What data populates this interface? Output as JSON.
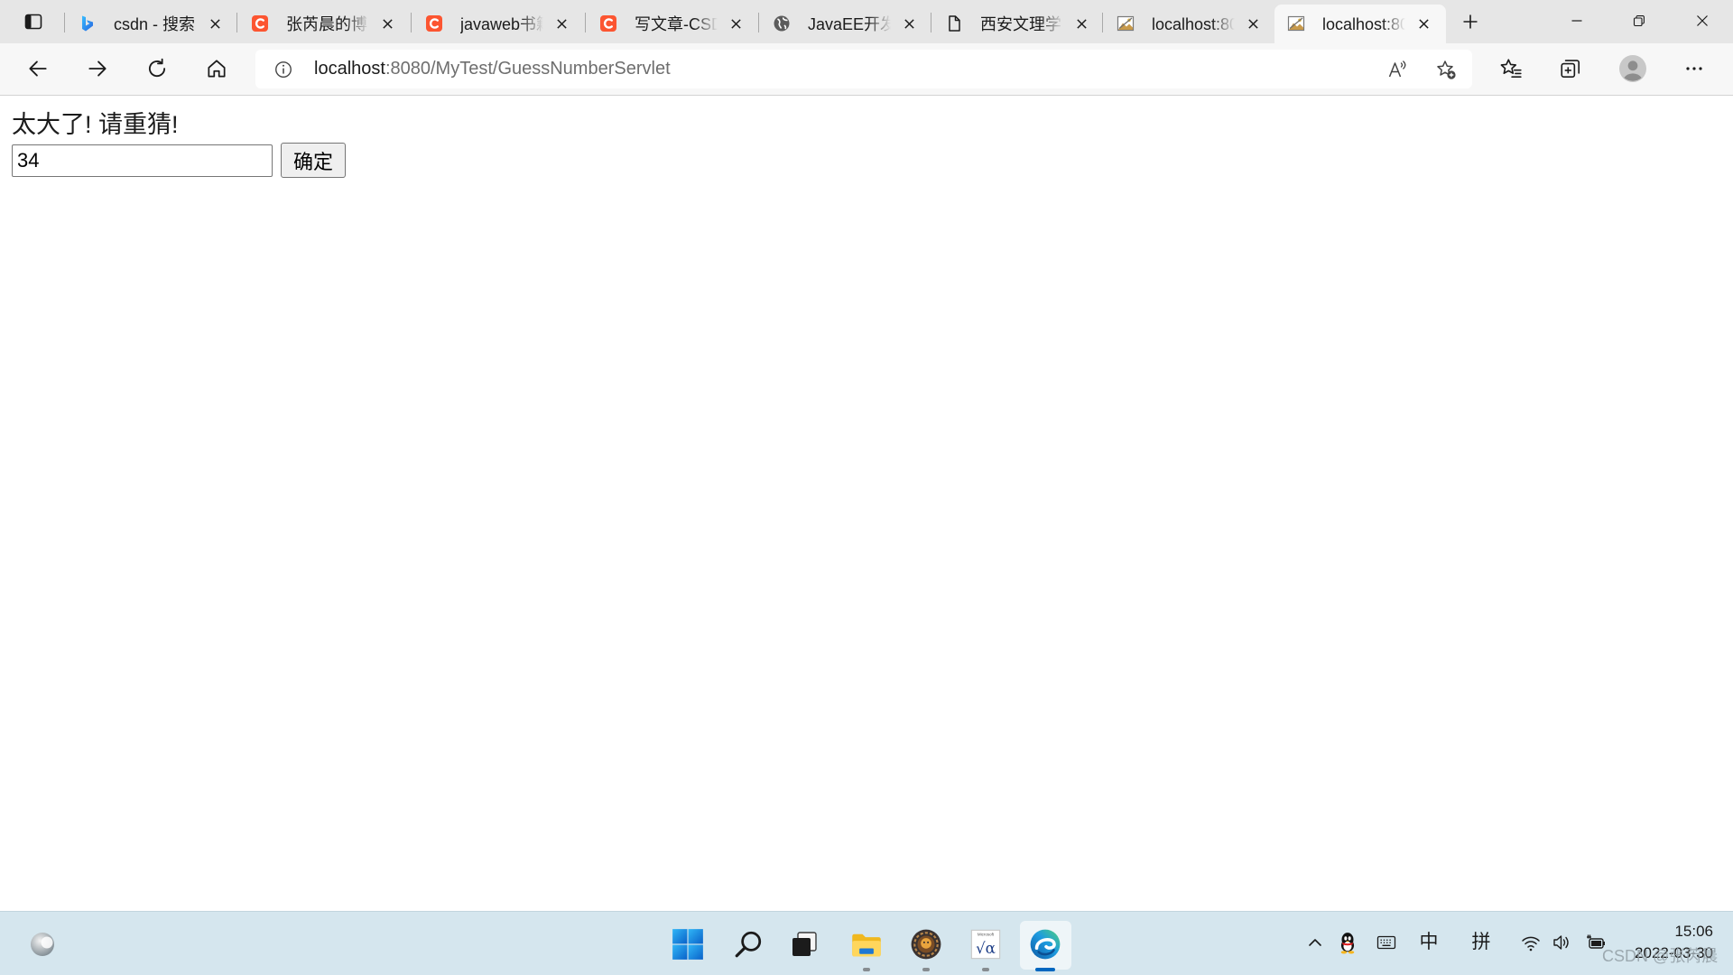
{
  "browser": {
    "tabs": [
      {
        "title": "csdn - 搜索",
        "icon": "bing-icon"
      },
      {
        "title": "张芮晨的博",
        "icon": "csdn-icon"
      },
      {
        "title": "javaweb书籍",
        "icon": "csdn-icon"
      },
      {
        "title": "写文章-CSD",
        "icon": "csdn-icon"
      },
      {
        "title": "JavaEE开发",
        "icon": "globe-icon"
      },
      {
        "title": "西安文理学",
        "icon": "document-icon"
      },
      {
        "title": "localhost:80",
        "icon": "broken-image-icon"
      },
      {
        "title": "localhost:80",
        "icon": "broken-image-icon",
        "active": true
      }
    ],
    "tab_strip_icons": [
      "vertical-tabs-icon",
      "new-tab-plus-icon",
      "minimize-icon",
      "restore-icon",
      "close-icon"
    ],
    "toolbar_icons": [
      "back-arrow-icon",
      "forward-arrow-icon",
      "refresh-icon",
      "home-icon",
      "favorites-icon",
      "collections-icon",
      "profile-avatar-icon",
      "more-dots-icon"
    ],
    "address": {
      "host": "localhost",
      "path": ":8080/MyTest/GuessNumberServlet",
      "icons": [
        "info-icon",
        "read-aloud-icon",
        "add-favorite-icon"
      ]
    }
  },
  "page": {
    "message": "太大了! 请重猜!",
    "guess_value": "34",
    "submit_label": "确定"
  },
  "taskbar": {
    "pinned": [
      {
        "icon": "widgets-weather-icon",
        "running": false
      },
      {
        "icon": "windows-start-icon",
        "running": false
      },
      {
        "icon": "search-icon",
        "running": false
      },
      {
        "icon": "task-view-icon",
        "running": false
      },
      {
        "icon": "folder-icon",
        "running": true
      },
      {
        "icon": "gear-badge-app-icon",
        "running": true
      },
      {
        "icon": "math-solver-icon",
        "running": true,
        "logo_text": "√α",
        "logo_caption": "Microsoft"
      },
      {
        "icon": "edge-browser-icon",
        "running": true,
        "active": true
      }
    ],
    "tray": {
      "icons": [
        "chevron-up-icon",
        "qq-penguin-icon",
        "keyboard-icon",
        "wifi-icon",
        "volume-icon",
        "battery-plug-icon"
      ],
      "ime_mode": "中",
      "ime_layout": "拼",
      "time": "15:06",
      "date": "2022-03-30"
    }
  },
  "watermark": "CSDN @张芮晨",
  "colors": {
    "tab_strip": "#e6e6e6",
    "toolbar": "#f7f7f7",
    "taskbar": "#d5e6ee",
    "accent": "#0067c0",
    "csdn_red": "#fc5531",
    "url_path": "#6e6e6e"
  }
}
